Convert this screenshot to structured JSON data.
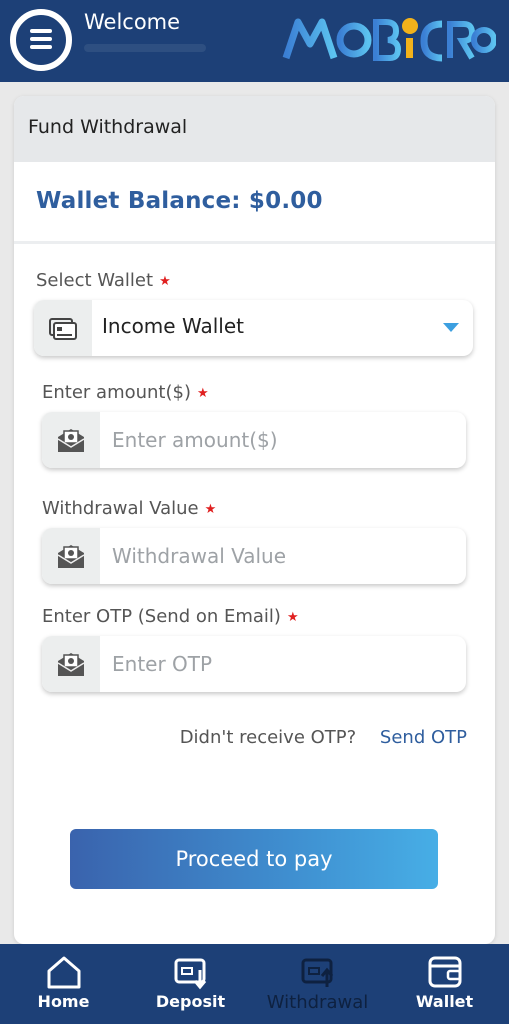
{
  "header": {
    "welcome": "Welcome",
    "logo_text": "MOBICRYO"
  },
  "page": {
    "title": "Fund Withdrawal",
    "balance": "Wallet Balance: $0.00"
  },
  "form": {
    "select_wallet_label": "Select Wallet",
    "select_wallet_value": "Income Wallet",
    "amount_label": "Enter amount($)",
    "amount_placeholder": "Enter amount($)",
    "withdrawal_label": "Withdrawal Value",
    "withdrawal_placeholder": "Withdrawal Value",
    "otp_label": "Enter OTP (Send on Email)",
    "otp_placeholder": "Enter OTP",
    "required_mark": "★",
    "otp_question": "Didn't receive OTP?",
    "send_otp": "Send OTP",
    "proceed": "Proceed to pay"
  },
  "nav": [
    {
      "label": "Home",
      "icon": "home-icon"
    },
    {
      "label": "Deposit",
      "icon": "deposit-icon"
    },
    {
      "label": "Withdrawal",
      "icon": "withdrawal-icon"
    },
    {
      "label": "Wallet",
      "icon": "wallet-icon"
    }
  ],
  "colors": {
    "header_bg": "#1d4077",
    "accent": "#2f5e9e",
    "required": "#e02020"
  }
}
